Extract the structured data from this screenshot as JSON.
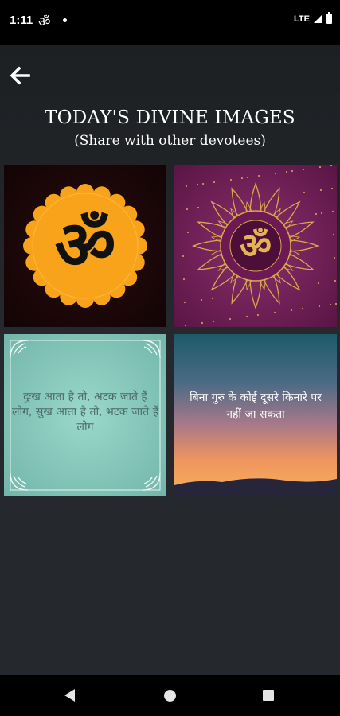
{
  "status_bar": {
    "time": "1:11",
    "notification_glyph": "ॐ",
    "network": "LTE",
    "icons": [
      "signal-icon",
      "battery-icon"
    ]
  },
  "header": {
    "back_icon": "arrow-left-icon",
    "title": "TODAY'S DIVINE IMAGES",
    "subtitle": "(Share with other devotees)"
  },
  "images": [
    {
      "name": "om-orange-flower",
      "glyph": "ॐ",
      "bg_color": "#1a0709",
      "accent": "#f9a31a"
    },
    {
      "name": "om-purple-mandala",
      "glyph": "ॐ",
      "bg_color": "#6e1d55",
      "accent": "#d8a94a"
    },
    {
      "name": "hindi-quote-teal",
      "text": "दुःख आता है तो, अटक जाते हैं लोग, सुख आता है तो, भटक जाते हैं लोग",
      "bg_color": "#8fcfc2"
    },
    {
      "name": "hindi-quote-sunset",
      "text": "बिना गुरु के कोई दूसरे किनारे पर नहीं जा सकता",
      "bg_color": "#e9a060"
    }
  ],
  "nav_bar": {
    "icons": [
      "nav-back-icon",
      "nav-home-icon",
      "nav-recents-icon"
    ]
  }
}
